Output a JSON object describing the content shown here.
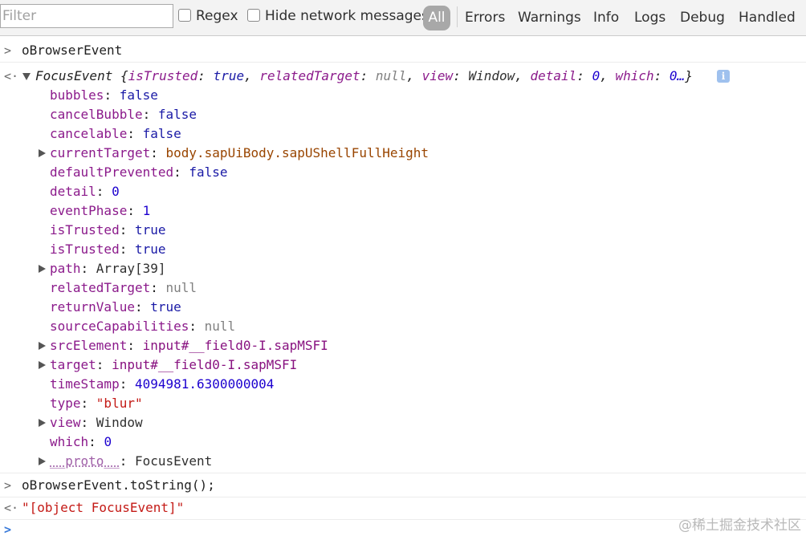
{
  "toolbar": {
    "filter_placeholder": "Filter",
    "regex_label": "Regex",
    "hide_network_label": "Hide network messages",
    "levels": [
      "All",
      "Errors",
      "Warnings",
      "Info",
      "Logs",
      "Debug",
      "Handled"
    ]
  },
  "console": {
    "command1": "oBrowserEvent",
    "preview": {
      "cls": "FocusEvent",
      "open": " {",
      "items": [
        {
          "k": "isTrusted",
          "v": "true",
          "c": ", "
        },
        {
          "k": "relatedTarget",
          "v": "null",
          "c": ", "
        },
        {
          "k": "view",
          "v": "Window",
          "c": ", "
        },
        {
          "k": "detail",
          "v": "0",
          "c": ", "
        },
        {
          "k": "which",
          "v": "0…",
          "c": "}"
        }
      ]
    },
    "props": [
      {
        "key": "bubbles",
        "value": "false",
        "vclass": "v-bool",
        "expandable": false,
        "dim": false
      },
      {
        "key": "cancelBubble",
        "value": "false",
        "vclass": "v-bool",
        "expandable": false,
        "dim": false
      },
      {
        "key": "cancelable",
        "value": "false",
        "vclass": "v-bool",
        "expandable": false,
        "dim": false
      },
      {
        "key": "currentTarget",
        "value": "body.sapUiBody.sapUShellFullHeight",
        "vclass": "v-cls",
        "expandable": true,
        "dim": false
      },
      {
        "key": "defaultPrevented",
        "value": "false",
        "vclass": "v-bool",
        "expandable": false,
        "dim": false
      },
      {
        "key": "detail",
        "value": "0",
        "vclass": "v-num",
        "expandable": false,
        "dim": false
      },
      {
        "key": "eventPhase",
        "value": "1",
        "vclass": "v-num",
        "expandable": false,
        "dim": false
      },
      {
        "key": "isTrusted",
        "value": "true",
        "vclass": "v-bool",
        "expandable": false,
        "dim": false
      },
      {
        "key": "isTrusted",
        "value": "true",
        "vclass": "v-bool",
        "expandable": false,
        "dim": false
      },
      {
        "key": "path",
        "value": "Array[39]",
        "vclass": "v-obj",
        "expandable": true,
        "dim": false
      },
      {
        "key": "relatedTarget",
        "value": "null",
        "vclass": "v-null",
        "expandable": false,
        "dim": false
      },
      {
        "key": "returnValue",
        "value": "true",
        "vclass": "v-bool",
        "expandable": false,
        "dim": false
      },
      {
        "key": "sourceCapabilities",
        "value": "null",
        "vclass": "v-null",
        "expandable": false,
        "dim": false
      },
      {
        "key": "srcElement",
        "value": "input#__field0-I.sapMSFI",
        "vclass": "v-node",
        "expandable": true,
        "dim": false
      },
      {
        "key": "target",
        "value": "input#__field0-I.sapMSFI",
        "vclass": "v-node",
        "expandable": true,
        "dim": false
      },
      {
        "key": "timeStamp",
        "value": "4094981.6300000004",
        "vclass": "v-num",
        "expandable": false,
        "dim": false
      },
      {
        "key": "type",
        "value": "\"blur\"",
        "vclass": "v-str",
        "expandable": false,
        "dim": false
      },
      {
        "key": "view",
        "value": "Window",
        "vclass": "v-obj",
        "expandable": true,
        "dim": false
      },
      {
        "key": "which",
        "value": "0",
        "vclass": "v-num",
        "expandable": false,
        "dim": false
      },
      {
        "key": "__proto__",
        "value": "FocusEvent",
        "vclass": "v-obj",
        "expandable": true,
        "dim": true
      }
    ],
    "command2": "oBrowserEvent.toString();",
    "result2": "\"[object FocusEvent]\""
  },
  "gutter_icons": {
    "input": "chevron-right-icon",
    "output": "return-arrow-icon",
    "prompt": "prompt-caret-icon"
  },
  "watermark": "@稀土掘金技术社区"
}
